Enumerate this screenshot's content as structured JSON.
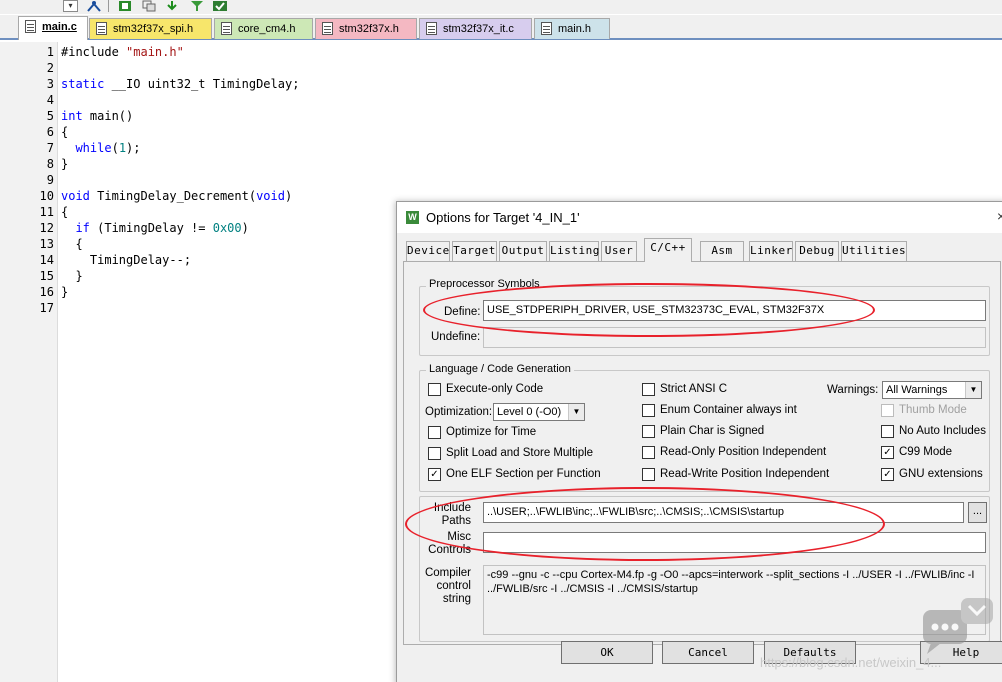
{
  "toolbar": {
    "dropdown_glyph": "▾"
  },
  "tabs": [
    {
      "label": "main.c",
      "active": true,
      "color": "#ffffff"
    },
    {
      "label": "stm32f37x_spi.h",
      "color": "#f7e66b"
    },
    {
      "label": "core_cm4.h",
      "color": "#cde8b6"
    },
    {
      "label": "stm32f37x.h",
      "color": "#f4b8c2"
    },
    {
      "label": "stm32f37x_it.c",
      "color": "#d7cdee"
    },
    {
      "label": "main.h",
      "color": "#cde2ea"
    }
  ],
  "editor": {
    "line_numbers": [
      "1",
      "2",
      "3",
      "4",
      "5",
      "6",
      "7",
      "8",
      "9",
      "10",
      "11",
      "12",
      "13",
      "14",
      "15",
      "16",
      "17"
    ],
    "lines": {
      "l1_pre": "#include ",
      "l1_str": "\"main.h\"",
      "l3_kw": "static",
      "l3_rest": " __IO uint32_t TimingDelay;",
      "l5_kw": "int",
      "l5_rest": " main()",
      "l6": "{",
      "l7_kw": "  while",
      "l7_open": "(",
      "l7_num": "1",
      "l7_close": ");",
      "l8": "}",
      "l10_kw": "void",
      "l10_mid": " TimingDelay_Decrement(",
      "l10_kw2": "void",
      "l10_end": ")",
      "l11": "{",
      "l12_kw": "  if",
      "l12_mid": " (TimingDelay != ",
      "l12_num": "0x00",
      "l12_end": ")",
      "l13": "  {",
      "l14": "    TimingDelay--;",
      "l15": "  }",
      "l16": "}"
    }
  },
  "dialog": {
    "title": "Options for Target '4_IN_1'",
    "close_glyph": "×",
    "app_icon_glyph": "W",
    "tabs": [
      "Device",
      "Target",
      "Output",
      "Listing",
      "User",
      "C/C++",
      "Asm",
      "Linker",
      "Debug",
      "Utilities"
    ],
    "active_tab": "C/C++",
    "preprocessor": {
      "title": "Preprocessor Symbols",
      "define_label": "Define:",
      "define_value": "USE_STDPERIPH_DRIVER, USE_STM32373C_EVAL, STM32F37X",
      "undefine_label": "Undefine:",
      "undefine_value": ""
    },
    "language": {
      "title": "Language / Code Generation",
      "execute_only": {
        "label": "Execute-only Code",
        "checked": false
      },
      "optimization_label": "Optimization:",
      "optimization_value": "Level 0 (-O0)",
      "optimize_time": {
        "label": "Optimize for Time",
        "checked": false
      },
      "split_load": {
        "label": "Split Load and Store Multiple",
        "checked": false
      },
      "one_elf": {
        "label": "One ELF Section per Function",
        "checked": true
      },
      "strict_ansi": {
        "label": "Strict ANSI C",
        "checked": false
      },
      "enum_container": {
        "label": "Enum Container always int",
        "checked": false
      },
      "plain_char": {
        "label": "Plain Char is Signed",
        "checked": false
      },
      "ro_pos": {
        "label": "Read-Only Position Independent",
        "checked": false
      },
      "rw_pos": {
        "label": "Read-Write Position Independent",
        "checked": false
      },
      "warnings_label": "Warnings:",
      "warnings_value": "All Warnings",
      "thumb_mode": {
        "label": "Thumb Mode",
        "checked": false,
        "disabled": true
      },
      "no_auto": {
        "label": "No Auto Includes",
        "checked": false
      },
      "c99": {
        "label": "C99 Mode",
        "checked": true
      },
      "gnu_ext": {
        "label": "GNU extensions",
        "checked": true
      }
    },
    "include": {
      "label_line1": "Include",
      "label_line2": "Paths",
      "value": "..\\USER;..\\FWLIB\\inc;..\\FWLIB\\src;..\\CMSIS;..\\CMSIS\\startup",
      "browse": "..."
    },
    "misc": {
      "label_line1": "Misc",
      "label_line2": "Controls",
      "value": ""
    },
    "compiler": {
      "label_line1": "Compiler",
      "label_line2": "control",
      "label_line3": "string",
      "value": "-c99 --gnu -c --cpu Cortex-M4.fp -g -O0 --apcs=interwork --split_sections -I ../USER -I ../FWLIB/inc -I ../FWLIB/src -I ../CMSIS -I ../CMSIS/startup"
    },
    "buttons": {
      "ok": "OK",
      "cancel": "Cancel",
      "defaults": "Defaults",
      "help": "Help"
    },
    "checkmark": "✓"
  },
  "annotations": {
    "ellipse_color": "#e8212b"
  },
  "watermark": {
    "text": "https://blog.csdn.net/weixin_4..."
  }
}
